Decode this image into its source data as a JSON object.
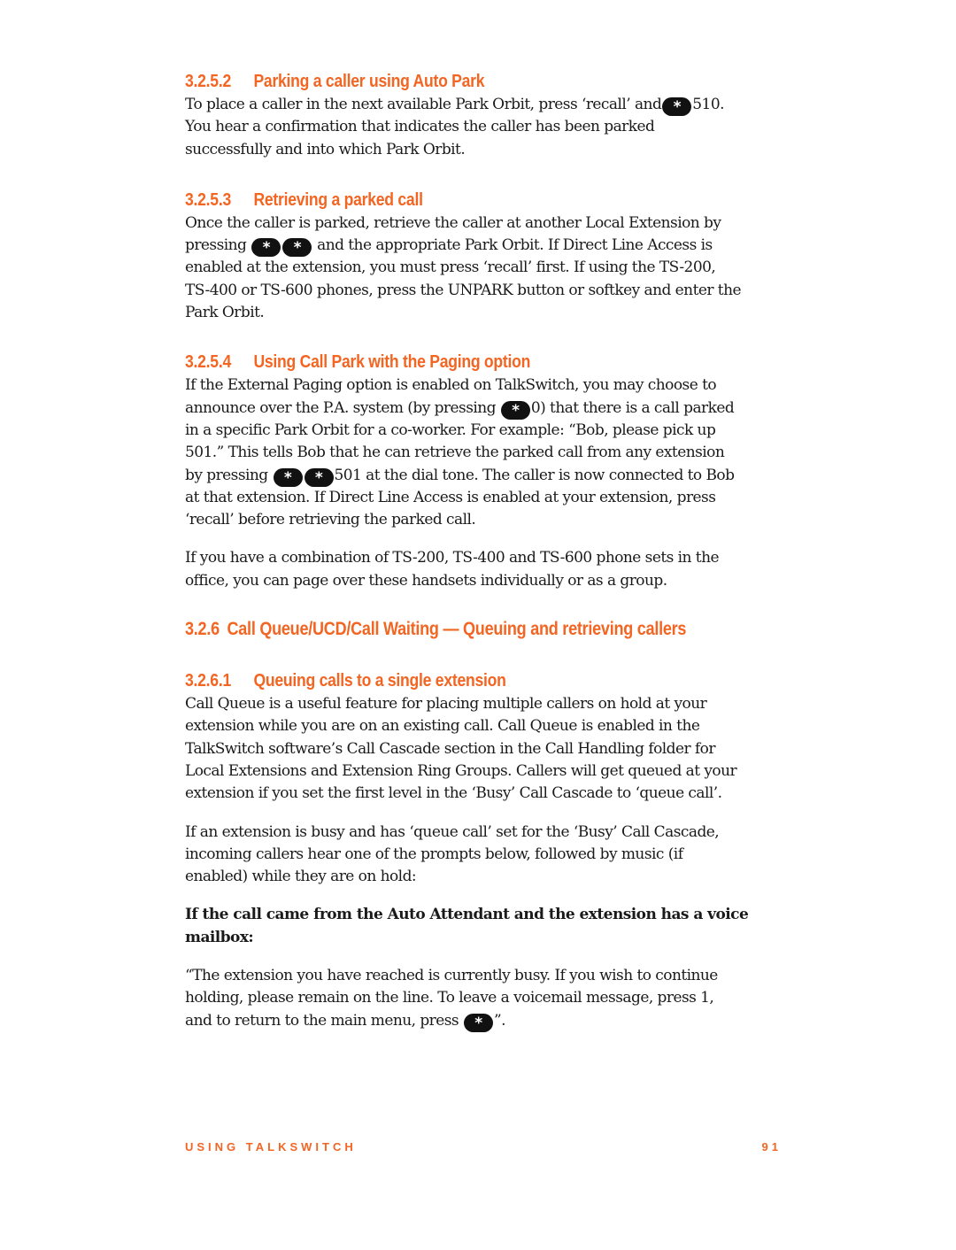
{
  "sections": {
    "s3252": {
      "number": "3.2.5.2",
      "title": "Parking a caller using Auto Park",
      "lines": [
        [
          "To place a caller in the next available Park Orbit, press ‘recall’ and",
          "star",
          "510."
        ],
        [
          "You hear a confirmation that indicates the caller has been parked"
        ],
        [
          "successfully and into which Park Orbit."
        ]
      ]
    },
    "s3253": {
      "number": "3.2.5.3",
      "title": "Retrieving a parked call",
      "line1": "Once the caller is parked, retrieve the caller at another Local Extension by",
      "line2_pre": "pressing",
      "line2_post": "and the appropriate Park Orbit. If Direct Line Access is",
      "line3": "enabled at the extension, you must press ‘recall’ first. If using the TS-200,",
      "line4": "TS-400 or TS-600 phones, press the UNPARK button or softkey and enter the",
      "line5": "Park Orbit."
    },
    "s3254": {
      "number": "3.2.5.4",
      "title": "Using Call Park with the Paging option",
      "line1": "If the External Paging option is enabled on TalkSwitch, you may choose to",
      "line2_pre": "announce over the P.A. system (by pressing",
      "line2_post": "0) that there is a call parked",
      "line3": "in a specific Park Orbit for a co-worker. For example: “Bob, please pick up",
      "line4": "501.” This tells Bob that he can retrieve the parked call from any extension",
      "line5_pre": "by pressing",
      "line5_post": "501 at the dial tone. The caller is now connected to Bob",
      "line6": "at that extension. If Direct Line Access is enabled at your extension, press",
      "line7": "‘recall’ before retrieving the parked call.",
      "para2_line1": "If you have a combination of TS-200, TS-400 and TS-600 phone sets in the",
      "para2_line2": "office, you can page over these handsets individually or as a group."
    },
    "s326": {
      "number": "3.2.6",
      "title": "Call Queue/UCD/Call Waiting — Queuing and retrieving callers"
    },
    "s3261": {
      "number": "3.2.6.1",
      "title": "Queuing calls to a single extension",
      "para1": [
        "Call Queue is a useful feature for placing multiple callers on hold at your",
        "extension while you are on an existing call. Call Queue is enabled in the",
        "TalkSwitch software’s Call Cascade section in the Call Handling folder for",
        "Local Extensions and Extension Ring Groups. Callers will get queued at your",
        "extension if you set the first level in the ‘Busy’ Call Cascade to ‘queue call’."
      ],
      "para2": [
        "If an extension is busy and has ‘queue call’ set for the ‘Busy’ Call Cascade,",
        "incoming callers hear one of the prompts below, followed by music (if",
        "enabled) while they are on hold:"
      ],
      "bold": [
        "If the call came from the Auto Attendant and the extension has a voice",
        "mailbox:"
      ],
      "quote1": "“The extension you have reached is currently busy. If you wish to continue",
      "quote2": "holding, please remain on the line. To leave a voicemail message, press 1,",
      "quote3_pre": "and to return to the main menu, press",
      "quote3_post": "”."
    }
  },
  "key_glyph": "*",
  "icons": {
    "star_key": "star-key-icon"
  },
  "footer": {
    "left": "USING TALKSWITCH",
    "right": "91"
  },
  "colors": {
    "heading": "#f26522",
    "body": "#1a1a1a",
    "key": "#111111"
  }
}
